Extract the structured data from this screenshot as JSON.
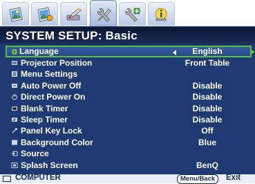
{
  "tabs": [
    {
      "name": "picture-icon",
      "active": false
    },
    {
      "name": "picture-advanced-icon",
      "active": false
    },
    {
      "name": "display-icon",
      "active": false
    },
    {
      "name": "system-setup-basic-icon",
      "active": true
    },
    {
      "name": "system-setup-advanced-icon",
      "active": false
    },
    {
      "name": "information-icon",
      "active": false
    }
  ],
  "header": {
    "title": "SYSTEM SETUP: Basic"
  },
  "menu": {
    "rows": [
      {
        "label": "Language",
        "value": "English",
        "icon": "language-icon"
      },
      {
        "label": "Projector Position",
        "value": "Front Table",
        "icon": "projector-position-icon"
      },
      {
        "label": "Menu Settings",
        "value": "",
        "icon": "menu-settings-icon"
      },
      {
        "label": "Auto Power Off",
        "value": "Disable",
        "icon": "auto-power-off-icon"
      },
      {
        "label": "Direct Power On",
        "value": "Disable",
        "icon": "direct-power-on-icon"
      },
      {
        "label": "Blank Timer",
        "value": "Disable",
        "icon": "blank-timer-icon"
      },
      {
        "label": "Sleep Timer",
        "value": "Disable",
        "icon": "sleep-timer-icon"
      },
      {
        "label": "Panel Key Lock",
        "value": "Off",
        "icon": "panel-key-lock-icon"
      },
      {
        "label": "Background Color",
        "value": "Blue",
        "icon": "background-color-icon"
      },
      {
        "label": "Source",
        "value": "",
        "icon": "source-icon"
      },
      {
        "label": "Splash Screen",
        "value": "BenQ",
        "icon": "splash-screen-icon"
      }
    ]
  },
  "footer": {
    "source": "COMPUTER",
    "menu_back": "Menu/Back",
    "exit": "Exit"
  },
  "colors": {
    "panel": "#1f3a73",
    "header": "#0c1630",
    "selection": "#58c23a",
    "footer": "#e9eef6"
  }
}
